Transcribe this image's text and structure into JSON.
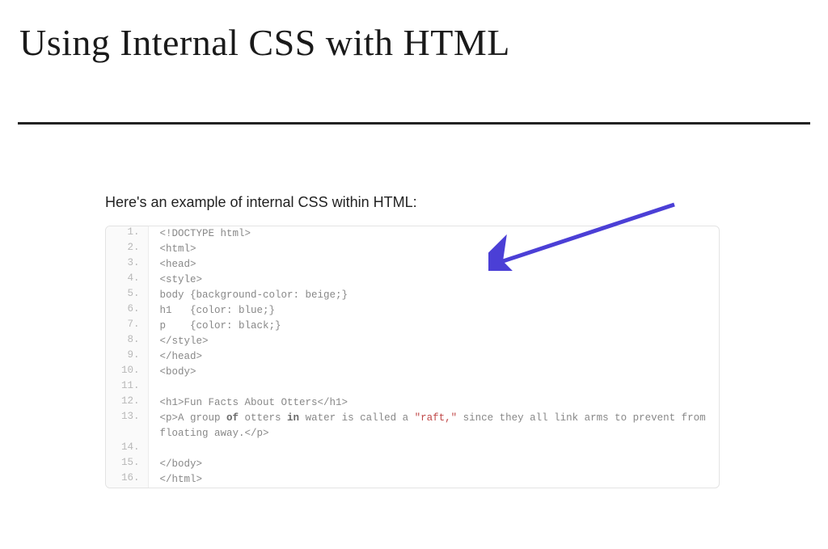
{
  "title": "Using Internal CSS with HTML",
  "intro": "Here's an example of internal CSS within HTML:",
  "code": {
    "lines": [
      {
        "n": "1.",
        "segments": [
          {
            "t": "<!DOCTYPE html>"
          }
        ]
      },
      {
        "n": "2.",
        "segments": [
          {
            "t": "<html>"
          }
        ]
      },
      {
        "n": "3.",
        "segments": [
          {
            "t": "<head>"
          }
        ]
      },
      {
        "n": "4.",
        "segments": [
          {
            "t": "<style>"
          }
        ]
      },
      {
        "n": "5.",
        "segments": [
          {
            "t": "body {background-color: beige;}"
          }
        ]
      },
      {
        "n": "6.",
        "segments": [
          {
            "t": "h1   {color: blue;}"
          }
        ]
      },
      {
        "n": "7.",
        "segments": [
          {
            "t": "p    {color: black;}"
          }
        ]
      },
      {
        "n": "8.",
        "segments": [
          {
            "t": "</style>"
          }
        ]
      },
      {
        "n": "9.",
        "segments": [
          {
            "t": "</head>"
          }
        ]
      },
      {
        "n": "10.",
        "segments": [
          {
            "t": "<body>"
          }
        ]
      },
      {
        "n": "11.",
        "segments": [
          {
            "t": ""
          }
        ]
      },
      {
        "n": "12.",
        "segments": [
          {
            "t": "<h1>Fun Facts About Otters</h1>"
          }
        ]
      },
      {
        "n": "13.",
        "segments": [
          {
            "t": "<p>A group "
          },
          {
            "t": "of",
            "cls": "kw"
          },
          {
            "t": " otters "
          },
          {
            "t": "in",
            "cls": "kw"
          },
          {
            "t": " water is called a "
          },
          {
            "t": "\"raft,\"",
            "cls": "str"
          },
          {
            "t": " since they all link arms to prevent from floating away.</p>"
          }
        ]
      },
      {
        "n": "14.",
        "segments": [
          {
            "t": ""
          }
        ]
      },
      {
        "n": "15.",
        "segments": [
          {
            "t": "</body>"
          }
        ]
      },
      {
        "n": "16.",
        "segments": [
          {
            "t": "</html>"
          }
        ]
      }
    ]
  },
  "annotation": {
    "arrow_color": "#4b3fd6"
  }
}
